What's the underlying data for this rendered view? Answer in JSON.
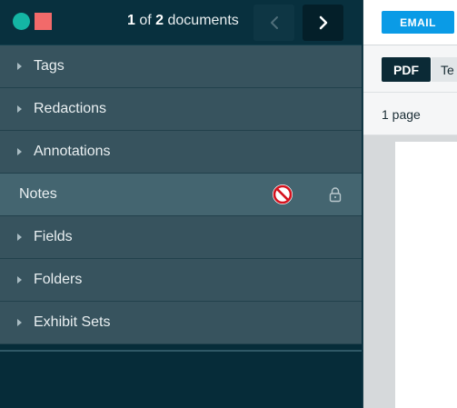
{
  "header": {
    "doc_index": "1",
    "doc_of": " of ",
    "doc_total": "2",
    "doc_suffix": " documents",
    "status_colors": {
      "teal": "#14b5a4",
      "red": "#f26a6a"
    }
  },
  "sidebar": {
    "items": [
      {
        "label": "Tags",
        "icon": "caret-right-icon"
      },
      {
        "label": "Redactions",
        "icon": "caret-right-icon"
      },
      {
        "label": "Annotations",
        "icon": "caret-right-icon"
      },
      {
        "label": "Notes",
        "icons": [
          "no-access-icon",
          "lock-icon"
        ],
        "active": true
      },
      {
        "label": "Fields",
        "icon": "caret-right-icon"
      },
      {
        "label": "Folders",
        "icon": "caret-right-icon"
      },
      {
        "label": "Exhibit Sets",
        "icon": "caret-right-icon"
      }
    ]
  },
  "viewer": {
    "email_label": "EMAIL",
    "tabs": [
      "PDF",
      "Te"
    ],
    "page_count": "1 page",
    "accent": "#0a9be6"
  }
}
